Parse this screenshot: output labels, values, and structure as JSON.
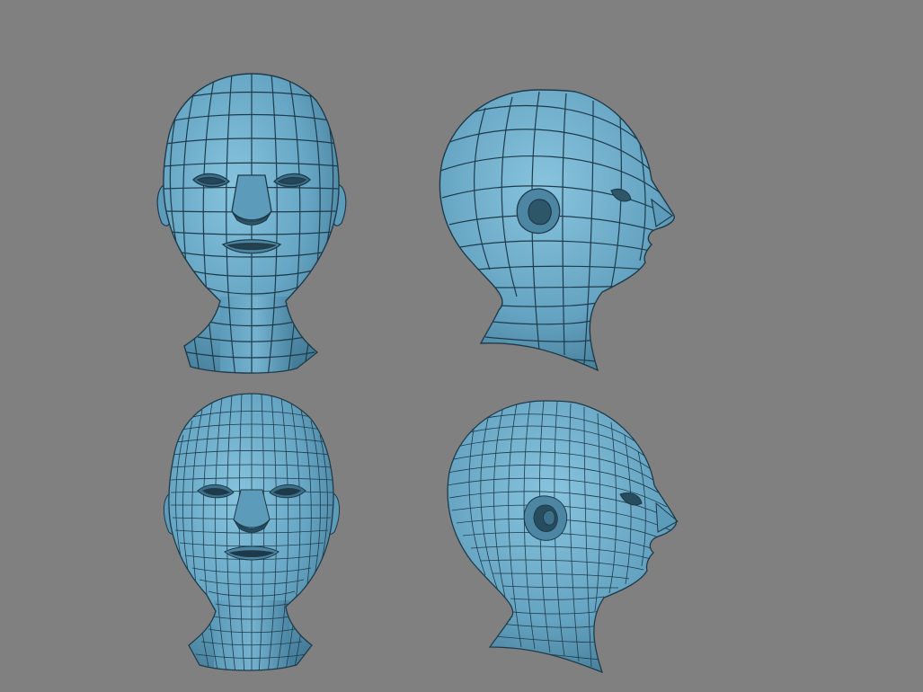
{
  "scene": {
    "background": "#808080",
    "mesh_fill_light": "#7ab8d4",
    "mesh_fill_mid": "#5f9fbf",
    "mesh_fill_dark": "#3c6f89",
    "wire_color": "#1f3b4a",
    "views": [
      {
        "name": "front-low-poly-head",
        "orientation": "front",
        "resolution": "low"
      },
      {
        "name": "side-low-poly-head",
        "orientation": "right-profile",
        "resolution": "low"
      },
      {
        "name": "front-subdivided-head",
        "orientation": "front",
        "resolution": "high"
      },
      {
        "name": "side-subdivided-head",
        "orientation": "right-profile",
        "resolution": "high"
      }
    ]
  }
}
